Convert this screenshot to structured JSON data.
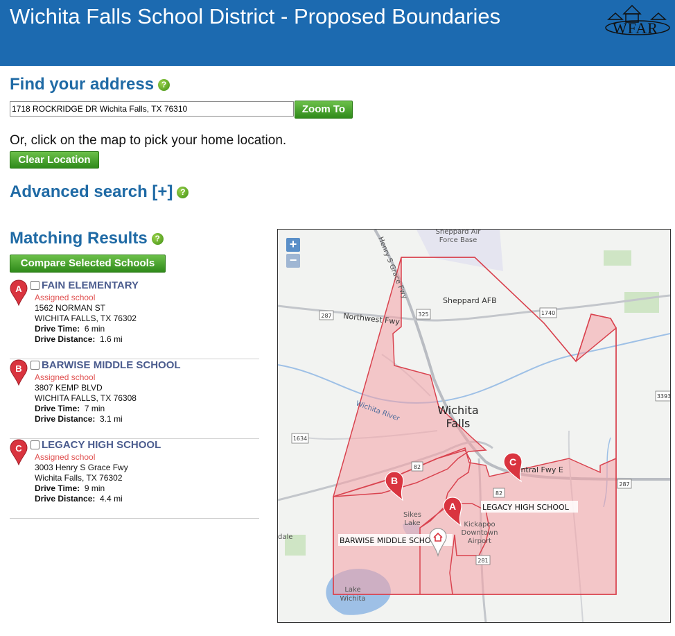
{
  "header": {
    "title": "Wichita Falls School District - Proposed Boundaries",
    "logo_text": "WFAR"
  },
  "find": {
    "heading": "Find your address",
    "help": "?",
    "address_value": "1718 ROCKRIDGE DR Wichita Falls, TX 76310",
    "zoom_button": "Zoom To",
    "or_text": "Or, click on the map to pick your home location.",
    "clear_button": "Clear Location"
  },
  "advanced": {
    "heading": "Advanced search [+]"
  },
  "results": {
    "heading": "Matching Results",
    "compare_button": "Compare Selected Schools",
    "items": [
      {
        "marker": "A",
        "name": "FAIN ELEMENTARY",
        "status": "Assigned school",
        "address": "1562 NORMAN ST",
        "city": "WICHITA FALLS, TX 76302",
        "time_label": "Drive Time:",
        "time": "6 min",
        "dist_label": "Drive Distance:",
        "dist": "1.6 mi"
      },
      {
        "marker": "B",
        "name": "BARWISE MIDDLE SCHOOL",
        "status": "Assigned school",
        "address": "3807 KEMP BLVD",
        "city": "WICHITA FALLS, TX 76308",
        "time_label": "Drive Time:",
        "time": "7 min",
        "dist_label": "Drive Distance:",
        "dist": "3.1 mi"
      },
      {
        "marker": "C",
        "name": "LEGACY HIGH SCHOOL",
        "status": "Assigned school",
        "address": "3003 Henry S Grace Fwy",
        "city": "Wichita Falls, TX 76302",
        "time_label": "Drive Time:",
        "time": "9 min",
        "dist_label": "Drive Distance:",
        "dist": "4.4 mi"
      }
    ]
  },
  "map": {
    "zoom_in": "+",
    "zoom_out": "−",
    "labels": {
      "sheppard_afb_base_1": "Sheppard Air",
      "sheppard_afb_base_2": "Force Base",
      "henry_grace": "Henry S Grace Fwy",
      "sheppard_afb": "Sheppard AFB",
      "northwest_fwy": "Northwest Fwy",
      "city_1": "Wichita",
      "city_2": "Falls",
      "river": "Wichita River",
      "central_fwy": "Central Fwy E",
      "sikes_1": "Sikes",
      "sikes_2": "Lake",
      "kickapoo_1": "Kickapoo",
      "kickapoo_2": "Downtown",
      "kickapoo_3": "Airport",
      "lake_1": "Lake",
      "lake_2": "Wichita",
      "dale": "dale",
      "legacy": "LEGACY HIGH SCHOOL",
      "barwise": "BARWISE MIDDLE SCHOOL",
      "shield_287a": "287",
      "shield_325": "325",
      "shield_1740": "1740",
      "shield_3393": "3393",
      "shield_1634": "1634",
      "shield_82a": "82",
      "shield_82b": "82",
      "shield_287b": "287",
      "shield_281": "281"
    },
    "markers": {
      "a": "A",
      "b": "B",
      "c": "C"
    }
  },
  "colors": {
    "banner": "#1c6ab0",
    "heading": "#1f6aa5",
    "boundary_fill": "#f4a0a6",
    "boundary_stroke": "#d9434f",
    "marker": "#d9343f",
    "school_name": "#4b5c8e",
    "assigned": "#e05050"
  }
}
